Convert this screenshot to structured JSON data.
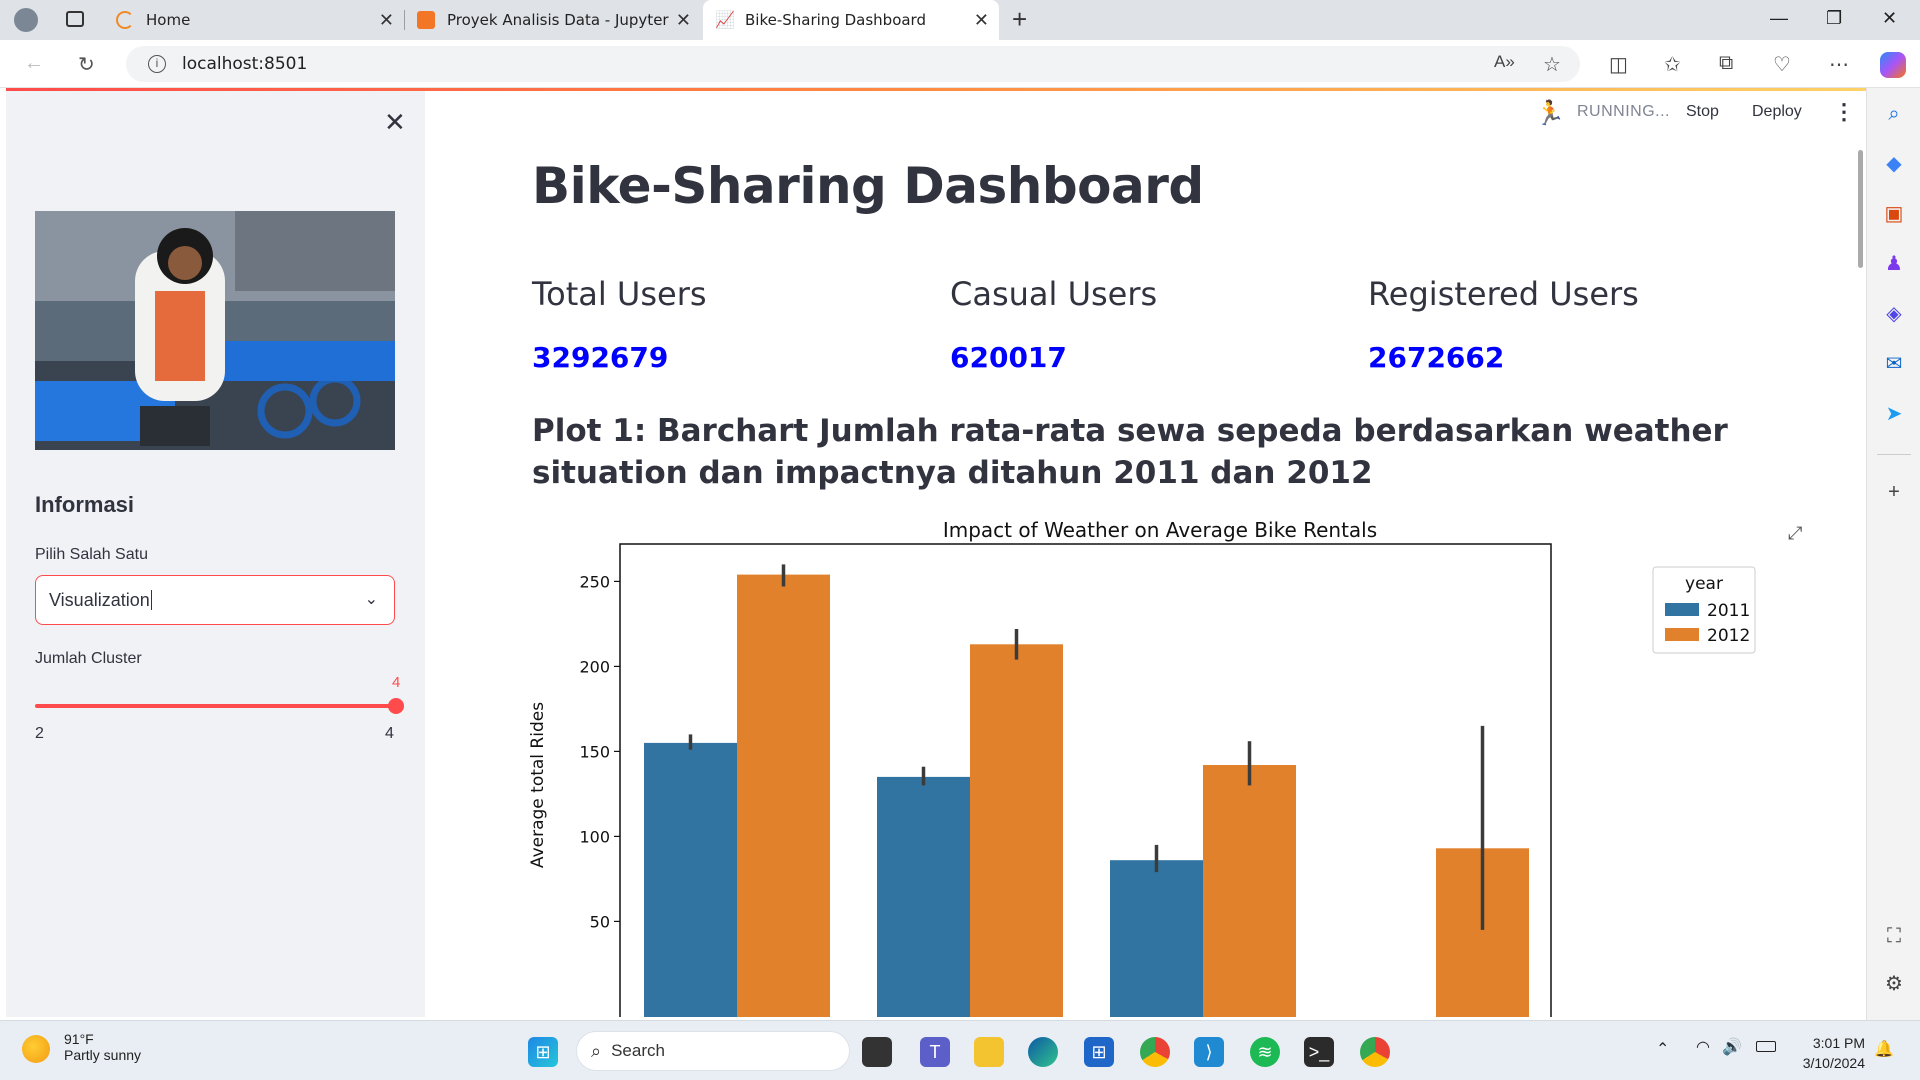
{
  "browser": {
    "tabs": [
      {
        "label": "Home"
      },
      {
        "label": "Proyek Analisis Data - Jupyter No"
      },
      {
        "label": "Bike-Sharing Dashboard"
      }
    ],
    "url": "localhost:8501"
  },
  "header": {
    "running": "RUNNING...",
    "stop": "Stop",
    "deploy": "Deploy"
  },
  "sidebar": {
    "heading": "Informasi",
    "select_label": "Pilih Salah Satu",
    "select_value": "Visualization",
    "slider_label": "Jumlah Cluster",
    "slider_value": "4",
    "slider_min": "2",
    "slider_max": "4"
  },
  "main": {
    "title": "Bike-Sharing Dashboard",
    "metrics": [
      {
        "label": "Total Users",
        "value": "3292679"
      },
      {
        "label": "Casual Users",
        "value": "620017"
      },
      {
        "label": "Registered Users",
        "value": "2672662"
      }
    ],
    "plot_heading": "Plot 1: Barchart Jumlah rata-rata sewa sepeda berdasarkan weather situation dan impactnya ditahun 2011 dan 2012"
  },
  "chart_data": {
    "type": "bar",
    "title": "Impact of Weather on Average Bike Rentals",
    "ylabel": "Average total Rides",
    "legend_title": "year",
    "legend_position": "top-right",
    "ylim": [
      50,
      272
    ],
    "yticks": [
      50,
      100,
      150,
      200,
      250
    ],
    "colors": {
      "2011": "#3274a1",
      "2012": "#e1812c"
    },
    "groups": 4,
    "series": [
      {
        "name": "2011",
        "values": [
          155,
          135,
          86,
          null
        ],
        "err": [
          [
            151,
            160
          ],
          [
            130,
            141
          ],
          [
            79,
            95
          ],
          null
        ]
      },
      {
        "name": "2012",
        "values": [
          254,
          213,
          142,
          93
        ],
        "err": [
          [
            247,
            260
          ],
          [
            204,
            222
          ],
          [
            130,
            156
          ],
          [
            45,
            165
          ]
        ]
      }
    ]
  },
  "taskbar": {
    "weather_temp": "91°F",
    "weather_desc": "Partly sunny",
    "search": "Search",
    "time": "3:01 PM",
    "date": "3/10/2024"
  }
}
